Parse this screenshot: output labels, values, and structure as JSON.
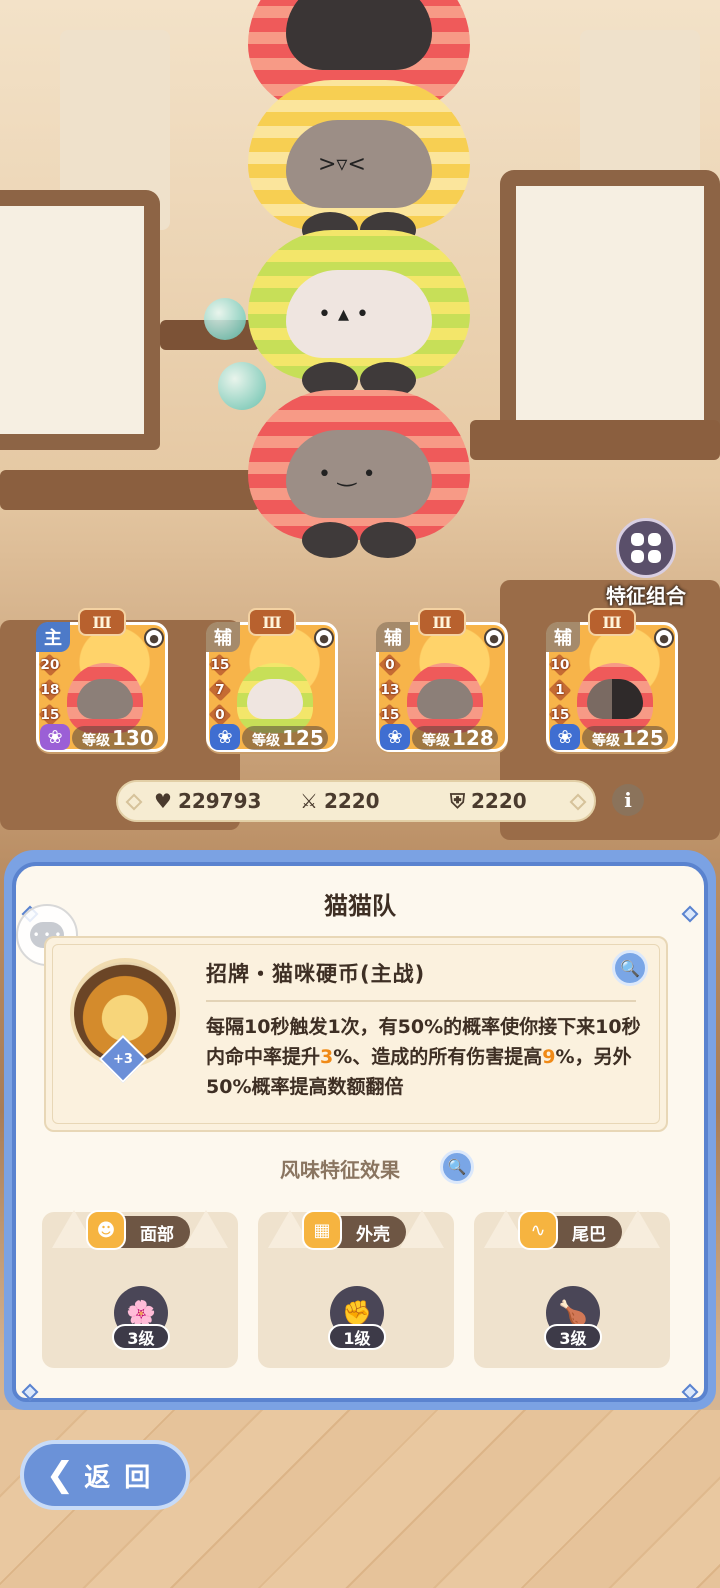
{
  "trait_combo": {
    "label": "特征组合",
    "icon": "clover-icon"
  },
  "team": [
    {
      "role": "主",
      "tier": "Ⅲ",
      "stats": [
        "20",
        "18",
        "15"
      ],
      "level_label": "等级",
      "level": "130",
      "paw_color": "#9b5fd6",
      "face": "grey"
    },
    {
      "role": "辅",
      "tier": "Ⅲ",
      "stats": [
        "15",
        "7",
        "0"
      ],
      "level_label": "等级",
      "level": "125",
      "paw_color": "#3f6ed1",
      "face": "light"
    },
    {
      "role": "辅",
      "tier": "Ⅲ",
      "stats": [
        "0",
        "13",
        "15"
      ],
      "level_label": "等级",
      "level": "128",
      "paw_color": "#3f6ed1",
      "face": "grey"
    },
    {
      "role": "辅",
      "tier": "Ⅲ",
      "stats": [
        "10",
        "1",
        "15"
      ],
      "level_label": "等级",
      "level": "125",
      "paw_color": "#3f6ed1",
      "face": "dark"
    }
  ],
  "power": {
    "hp": "229793",
    "attack": "2220",
    "defense": "2220"
  },
  "panel": {
    "title": "猫猫队",
    "skill": {
      "name": "招牌・猫咪硬币(主战)",
      "bonus": "+3",
      "desc_parts": [
        "每隔10秒触发1次，有50%的概率使你接下来10秒内命中率提升",
        "3",
        "%、造成的所有伤害提高",
        "9",
        "%，另外50%概率提高数额翻倍"
      ]
    },
    "flavor_title": "风味特征效果",
    "features": [
      {
        "name": "面部",
        "level": "3级",
        "icon": "flower-icon"
      },
      {
        "name": "外壳",
        "level": "1级",
        "icon": "fist-icon"
      },
      {
        "name": "尾巴",
        "level": "3级",
        "icon": "drumstick-icon"
      }
    ]
  },
  "back_label": "返回",
  "colors": {
    "accent_blue": "#5a83cf",
    "highlight_orange": "#f08a17",
    "panel_bg": "#fdf8ee"
  }
}
